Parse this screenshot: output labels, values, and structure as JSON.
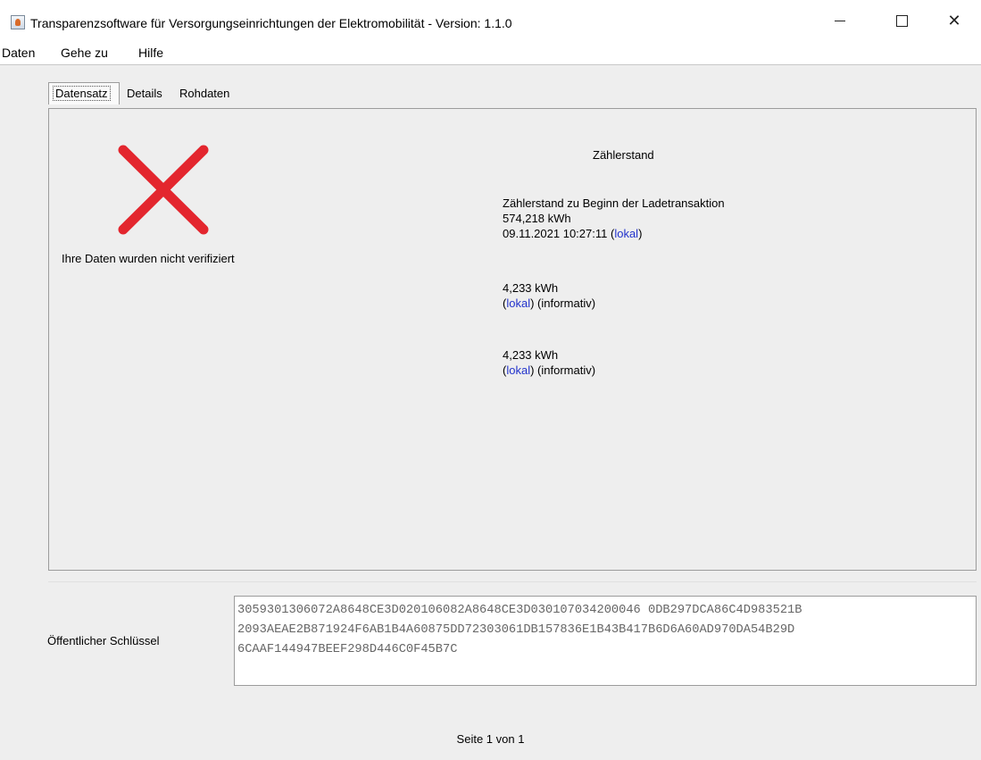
{
  "window": {
    "title": "Transparenzsoftware für Versorgungseinrichtungen der Elektromobilität - Version: 1.1.0",
    "minimize": "—",
    "maximize": "☐",
    "close": "✕"
  },
  "menu": {
    "items": [
      "Daten",
      "Gehe zu",
      "Hilfe"
    ]
  },
  "tabs": [
    "Datensatz",
    "Details",
    "Rohdaten"
  ],
  "verification": {
    "status_icon": "red-x-icon",
    "color": "#e3262e",
    "message": "Ihre Daten wurden nicht verifiziert"
  },
  "meter": {
    "title": "Zählerstand",
    "start": {
      "label": "Zählerstand zu Beginn der Ladetransaktion",
      "value": "574,218 kWh",
      "timestamp": "09.11.2021 10:27:11",
      "link": "lokal"
    },
    "entries": [
      {
        "value": "4,233 kWh",
        "link": "lokal",
        "note": "(informativ)"
      },
      {
        "value": "4,233 kWh",
        "link": "lokal",
        "note": "(informativ)"
      }
    ]
  },
  "public_key": {
    "label": "Öffentlicher Schlüssel",
    "lines": [
      "3059301306072A8648CE3D020106082A8648CE3D030107034200046 0DB297DCA86C4D983521B",
      "2093AEAE2B871924F6AB1B4A60875DD72303061DB157836E1B43B417B6D6A60AD970DA54B29D",
      "6CAAF144947BEEF298D446C0F45B7C"
    ]
  },
  "footer": {
    "page": "Seite 1 von 1"
  }
}
